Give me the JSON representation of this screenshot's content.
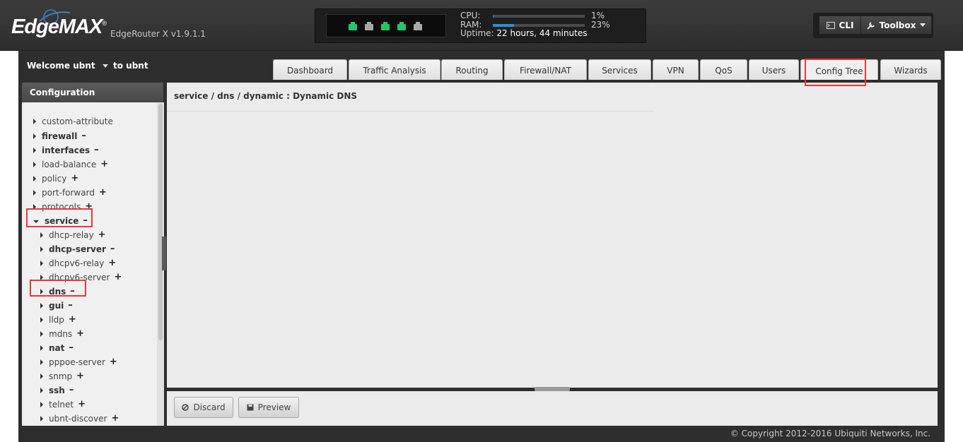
{
  "header": {
    "logo": "EdgeMAX",
    "logo_mark": "®",
    "version": "EdgeRouter X v1.9.1.1",
    "cpu_label": "CPU:",
    "cpu_percent": "1%",
    "cpu_value": 1,
    "ram_label": "RAM:",
    "ram_percent": "23%",
    "ram_value": 23,
    "uptime_label": "Uptime:",
    "uptime_value": "22 hours, 44 minutes",
    "ports": [
      "connected",
      "disconnected",
      "connected",
      "connected",
      "disconnected"
    ],
    "port_colors": {
      "connected": "#25c468",
      "disconnected": "#a8a8a8"
    },
    "cli_label": "CLI",
    "toolbox_label": "Toolbox"
  },
  "subbar": {
    "welcome": "Welcome ubnt",
    "to_user": "to ubnt"
  },
  "tabs": [
    "Dashboard",
    "Traffic Analysis",
    "Routing",
    "Firewall/NAT",
    "Services",
    "VPN",
    "QoS",
    "Users",
    "Config Tree",
    "Wizards"
  ],
  "active_tab": "Config Tree",
  "sidebar": {
    "title": "Configuration",
    "items": [
      {
        "label": "custom-attribute",
        "sign": "",
        "bold": false,
        "expanded": false,
        "depth": 0
      },
      {
        "label": "firewall",
        "sign": "–",
        "bold": true,
        "expanded": false,
        "depth": 0
      },
      {
        "label": "interfaces",
        "sign": "–",
        "bold": true,
        "expanded": false,
        "depth": 0
      },
      {
        "label": "load-balance",
        "sign": "+",
        "bold": false,
        "expanded": false,
        "depth": 0
      },
      {
        "label": "policy",
        "sign": "+",
        "bold": false,
        "expanded": false,
        "depth": 0
      },
      {
        "label": "port-forward",
        "sign": "+",
        "bold": false,
        "expanded": false,
        "depth": 0
      },
      {
        "label": "protocols",
        "sign": "+",
        "bold": false,
        "expanded": false,
        "depth": 0
      },
      {
        "label": "service",
        "sign": "–",
        "bold": true,
        "expanded": true,
        "depth": 0
      },
      {
        "label": "dhcp-relay",
        "sign": "+",
        "bold": false,
        "expanded": false,
        "depth": 1
      },
      {
        "label": "dhcp-server",
        "sign": "–",
        "bold": true,
        "expanded": false,
        "depth": 1
      },
      {
        "label": "dhcpv6-relay",
        "sign": "+",
        "bold": false,
        "expanded": false,
        "depth": 1
      },
      {
        "label": "dhcpv6-server",
        "sign": "+",
        "bold": false,
        "expanded": false,
        "depth": 1
      },
      {
        "label": "dns",
        "sign": "–",
        "bold": true,
        "expanded": false,
        "depth": 1
      },
      {
        "label": "gui",
        "sign": "–",
        "bold": true,
        "expanded": false,
        "depth": 1
      },
      {
        "label": "lldp",
        "sign": "+",
        "bold": false,
        "expanded": false,
        "depth": 1
      },
      {
        "label": "mdns",
        "sign": "+",
        "bold": false,
        "expanded": false,
        "depth": 1
      },
      {
        "label": "nat",
        "sign": "–",
        "bold": true,
        "expanded": false,
        "depth": 1
      },
      {
        "label": "pppoe-server",
        "sign": "+",
        "bold": false,
        "expanded": false,
        "depth": 1
      },
      {
        "label": "snmp",
        "sign": "+",
        "bold": false,
        "expanded": false,
        "depth": 1
      },
      {
        "label": "ssh",
        "sign": "–",
        "bold": true,
        "expanded": false,
        "depth": 1
      },
      {
        "label": "telnet",
        "sign": "+",
        "bold": false,
        "expanded": false,
        "depth": 1
      },
      {
        "label": "ubnt-discover",
        "sign": "+",
        "bold": false,
        "expanded": false,
        "depth": 1
      }
    ]
  },
  "content": {
    "title": "service / dns / dynamic : Dynamic DNS"
  },
  "actions": {
    "discard_label": "Discard",
    "preview_label": "Preview"
  },
  "footer": {
    "copyright": "© Copyright 2012-2016 Ubiquiti Networks, Inc."
  },
  "highlight_color": "#e8383d"
}
